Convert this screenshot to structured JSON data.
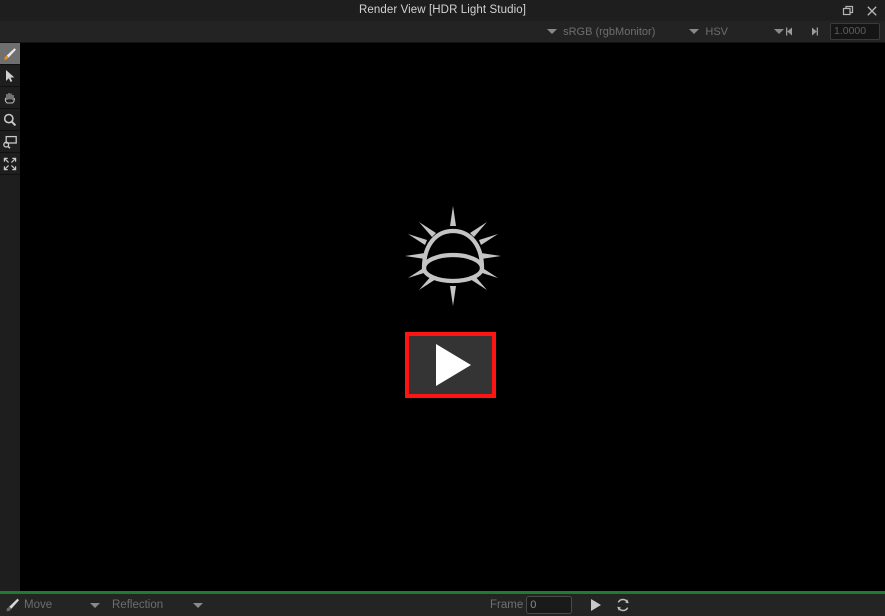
{
  "window": {
    "title": "Render View [HDR Light Studio]",
    "buttons": [
      {
        "name": "restore-button",
        "icon": "restore-icon"
      },
      {
        "name": "close-button",
        "icon": "close-icon"
      }
    ]
  },
  "toolbar": {
    "color_space": "sRGB (rgbMonitor)",
    "color_model": "HSV",
    "exposure_value": "1.0000",
    "prev_arrow_icon": "step-backward-icon",
    "next_arrow_icon": "step-forward-icon"
  },
  "tool_rail": {
    "items": [
      {
        "label": "Paint",
        "icon": "brush-icon",
        "active": true
      },
      {
        "label": "Select",
        "icon": "arrow-cursor-icon",
        "active": false
      },
      {
        "label": "Pan",
        "icon": "hand-icon",
        "active": false
      },
      {
        "label": "Zoom",
        "icon": "magnifier-icon",
        "active": false
      },
      {
        "label": "Zoom Region",
        "icon": "zoom-region-icon",
        "active": false
      },
      {
        "label": "Zoom Fit",
        "icon": "zoom-fit-icon",
        "active": false
      }
    ]
  },
  "canvas": {
    "placeholder_icon": "hdr-dome-sun-icon",
    "play_button_label": "Render",
    "play_icon": "play-triangle-icon",
    "highlight_color": "#ff1414",
    "background_color": "#000000"
  },
  "statusbar": {
    "brush_icon": "brush-icon",
    "mode": "Move",
    "mapping": "Reflection",
    "frame_label": "Frame",
    "frame_value": "0",
    "play_icon": "play-triangle-icon",
    "loop_icon": "loop-refresh-icon",
    "accent_color": "#1f7a32"
  }
}
